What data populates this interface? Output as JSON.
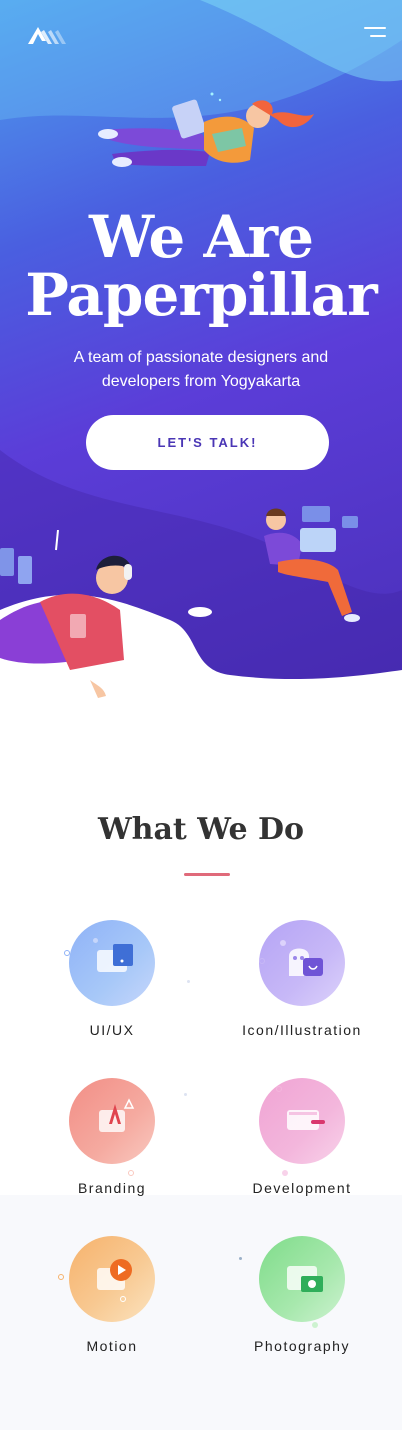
{
  "hero": {
    "title_line1": "We Are",
    "title_line2": "Paperpillar",
    "subtitle": "A team of passionate designers and developers from Yogyakarta",
    "cta_label": "LET'S TALK!"
  },
  "nav": {
    "logo_icon": "paperpillar-logo-icon",
    "menu_icon": "hamburger-menu-icon"
  },
  "what_we_do": {
    "title": "What We Do",
    "services": [
      {
        "label": "UI/UX",
        "icon": "ui-ux-icon"
      },
      {
        "label": "Icon/Illustration",
        "icon": "icon-illustration-icon"
      },
      {
        "label": "Branding",
        "icon": "branding-icon"
      },
      {
        "label": "Development",
        "icon": "development-icon"
      },
      {
        "label": "Motion",
        "icon": "motion-icon"
      },
      {
        "label": "Photography",
        "icon": "photography-icon"
      }
    ]
  },
  "colors": {
    "hero_top": "#4fa0ee",
    "hero_bottom": "#4a2fb8",
    "accent_line": "#e06a7a",
    "cta_text": "#4a36b5"
  }
}
